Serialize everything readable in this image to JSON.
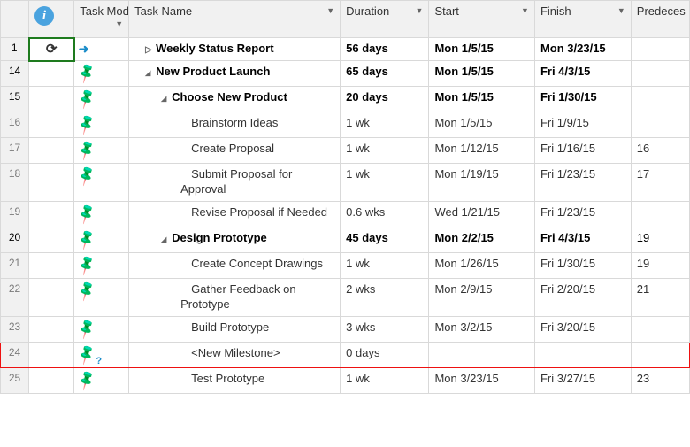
{
  "columns": {
    "info": "",
    "task_mode": "Task Mode",
    "task_name": "Task Name",
    "duration": "Duration",
    "start": "Start",
    "finish": "Finish",
    "predecessors": "Predeces"
  },
  "rows": [
    {
      "num": "1",
      "mode": "auto",
      "indent": 1,
      "toggle": "right",
      "bold": true,
      "name": "Weekly Status Report",
      "duration": "56 days",
      "start": "Mon 1/5/15",
      "finish": "Mon 3/23/15",
      "pred": "",
      "info_refresh": true
    },
    {
      "num": "14",
      "mode": "manual",
      "indent": 1,
      "toggle": "down",
      "bold": true,
      "name": "New Product Launch",
      "duration": "65 days",
      "start": "Mon 1/5/15",
      "finish": "Fri 4/3/15",
      "pred": ""
    },
    {
      "num": "15",
      "mode": "manual",
      "indent": 2,
      "toggle": "down",
      "bold": true,
      "name": "Choose New Product",
      "duration": "20 days",
      "start": "Mon 1/5/15",
      "finish": "Fri 1/30/15",
      "pred": ""
    },
    {
      "num": "16",
      "mode": "manual",
      "indent": 3,
      "toggle": "",
      "bold": false,
      "name": "Brainstorm Ideas",
      "duration": "1 wk",
      "start": "Mon 1/5/15",
      "finish": "Fri 1/9/15",
      "pred": ""
    },
    {
      "num": "17",
      "mode": "manual",
      "indent": 3,
      "toggle": "",
      "bold": false,
      "name": "Create Proposal",
      "duration": "1 wk",
      "start": "Mon 1/12/15",
      "finish": "Fri 1/16/15",
      "pred": "16"
    },
    {
      "num": "18",
      "mode": "manual",
      "indent": 3,
      "toggle": "",
      "bold": false,
      "name": "Submit Proposal for Approval",
      "duration": "1 wk",
      "start": "Mon 1/19/15",
      "finish": "Fri 1/23/15",
      "pred": "17"
    },
    {
      "num": "19",
      "mode": "manual",
      "indent": 3,
      "toggle": "",
      "bold": false,
      "name": "Revise Proposal if Needed",
      "duration": "0.6 wks",
      "start": "Wed 1/21/15",
      "finish": "Fri 1/23/15",
      "pred": ""
    },
    {
      "num": "20",
      "mode": "manual",
      "indent": 2,
      "toggle": "down",
      "bold": true,
      "name": "Design Prototype",
      "duration": "45 days",
      "start": "Mon 2/2/15",
      "finish": "Fri 4/3/15",
      "pred": "19"
    },
    {
      "num": "21",
      "mode": "manual",
      "indent": 3,
      "toggle": "",
      "bold": false,
      "name": "Create Concept Drawings",
      "duration": "1 wk",
      "start": "Mon 1/26/15",
      "finish": "Fri 1/30/15",
      "pred": "19"
    },
    {
      "num": "22",
      "mode": "manual",
      "indent": 3,
      "toggle": "",
      "bold": false,
      "name": "Gather Feedback on Prototype",
      "duration": "2 wks",
      "start": "Mon 2/9/15",
      "finish": "Fri 2/20/15",
      "pred": "21"
    },
    {
      "num": "23",
      "mode": "manual",
      "indent": 3,
      "toggle": "",
      "bold": false,
      "name": "Build Prototype",
      "duration": "3 wks",
      "start": "Mon 3/2/15",
      "finish": "Fri 3/20/15",
      "pred": ""
    },
    {
      "num": "24",
      "mode": "manual-q",
      "indent": 3,
      "toggle": "",
      "bold": false,
      "name": "<New Milestone>",
      "duration": "0 days",
      "start": "",
      "finish": "",
      "pred": "",
      "highlight": true
    },
    {
      "num": "25",
      "mode": "manual",
      "indent": 3,
      "toggle": "",
      "bold": false,
      "name": "Test Prototype",
      "duration": "1 wk",
      "start": "Mon 3/23/15",
      "finish": "Fri 3/27/15",
      "pred": "23"
    }
  ]
}
